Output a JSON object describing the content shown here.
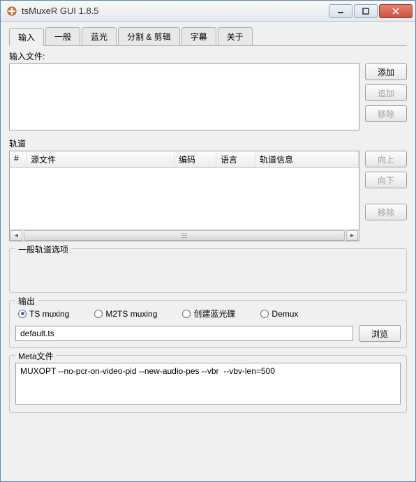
{
  "window": {
    "title": "tsMuxeR GUI 1.8.5"
  },
  "tabs": [
    {
      "label": "输入",
      "active": true
    },
    {
      "label": "一般",
      "active": false
    },
    {
      "label": "蓝光",
      "active": false
    },
    {
      "label": "分割 & 剪辑",
      "active": false
    },
    {
      "label": "字幕",
      "active": false
    },
    {
      "label": "关于",
      "active": false
    }
  ],
  "input_files": {
    "label": "输入文件:",
    "buttons": {
      "add": "添加",
      "append": "追加",
      "remove": "移除"
    }
  },
  "tracks": {
    "label": "轨道",
    "columns": {
      "num": "#",
      "source": "源文件",
      "codec": "编码",
      "lang": "语言",
      "info": "轨道信息"
    },
    "rows": [],
    "buttons": {
      "up": "向上",
      "down": "向下",
      "remove": "移除"
    }
  },
  "general_options": {
    "label": "一般轨道选项"
  },
  "output": {
    "label": "输出",
    "radios": {
      "ts": "TS muxing",
      "m2ts": "M2TS muxing",
      "bluray": "创建蓝光碟",
      "demux": "Demux"
    },
    "selected": "ts",
    "path": "default.ts",
    "browse": "浏览"
  },
  "meta": {
    "label": "Meta文件",
    "content": "MUXOPT --no-pcr-on-video-pid --new-audio-pes --vbr  --vbv-len=500"
  }
}
